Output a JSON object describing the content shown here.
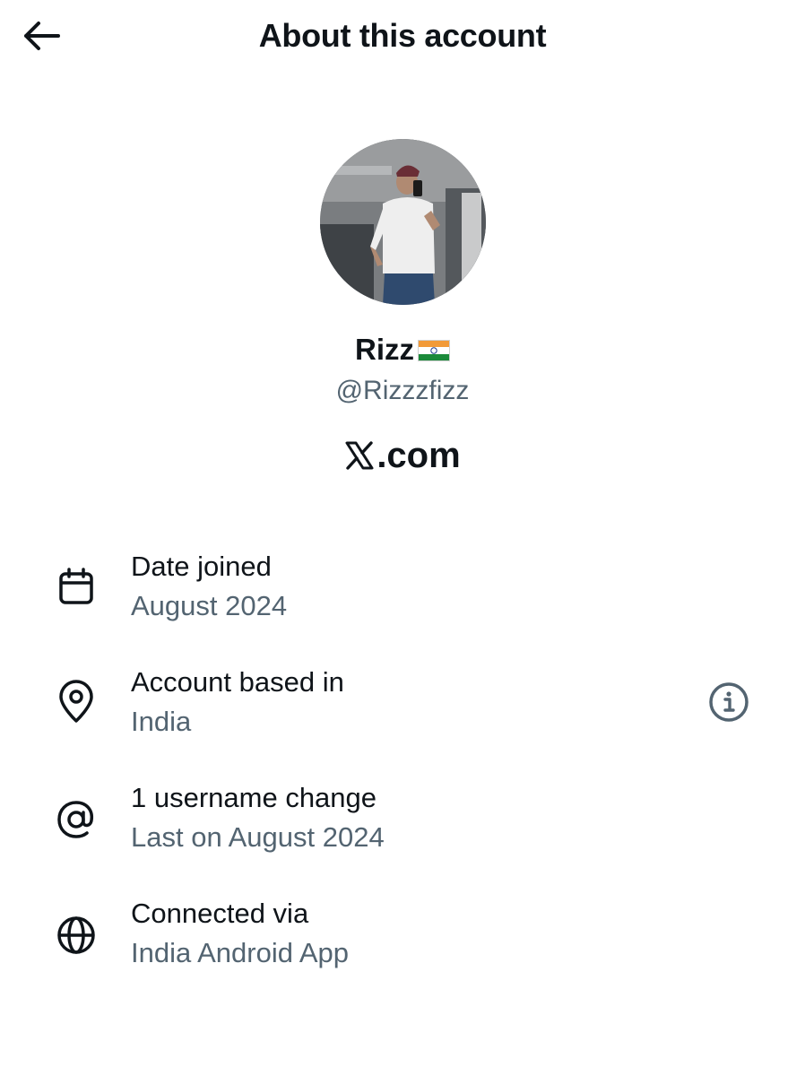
{
  "header": {
    "title": "About this account",
    "back_icon": "arrow-left-icon"
  },
  "profile": {
    "display_name": "Rizz",
    "flag_icon": "india-flag-icon",
    "handle": "@Rizzzfizz",
    "platform": ".com",
    "platform_logo": "x-logo-icon"
  },
  "rows": [
    {
      "icon": "calendar-icon",
      "label": "Date joined",
      "value": "August 2024"
    },
    {
      "icon": "location-pin-icon",
      "label": "Account based in",
      "value": "India",
      "action_icon": "info-icon"
    },
    {
      "icon": "at-sign-icon",
      "label": "1 username change",
      "value": "Last on August 2024"
    },
    {
      "icon": "globe-icon",
      "label": "Connected via",
      "value": "India Android App"
    }
  ],
  "colors": {
    "text_primary": "#0f1419",
    "text_secondary": "#536471"
  }
}
